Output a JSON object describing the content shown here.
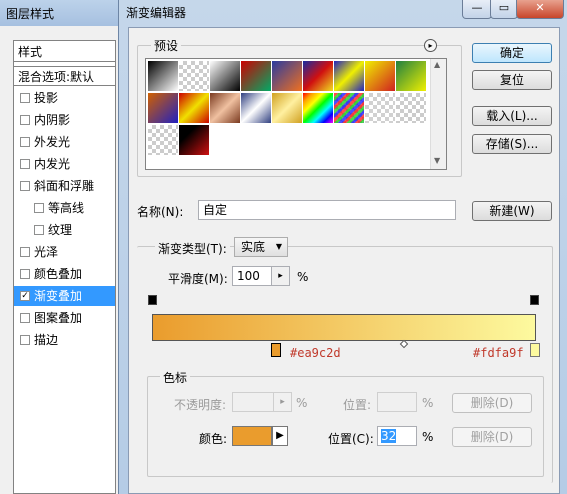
{
  "left_window": {
    "title": "图层样式",
    "header": "样式",
    "blend": "混合选项:默认",
    "items": [
      {
        "label": "投影",
        "checked": false,
        "indent": false
      },
      {
        "label": "内阴影",
        "checked": false,
        "indent": false
      },
      {
        "label": "外发光",
        "checked": false,
        "indent": false
      },
      {
        "label": "内发光",
        "checked": false,
        "indent": false
      },
      {
        "label": "斜面和浮雕",
        "checked": false,
        "indent": false
      },
      {
        "label": "等高线",
        "checked": false,
        "indent": true
      },
      {
        "label": "纹理",
        "checked": false,
        "indent": true
      },
      {
        "label": "光泽",
        "checked": false,
        "indent": false
      },
      {
        "label": "颜色叠加",
        "checked": false,
        "indent": false
      },
      {
        "label": "渐变叠加",
        "checked": true,
        "indent": false,
        "selected": true
      },
      {
        "label": "图案叠加",
        "checked": false,
        "indent": false
      },
      {
        "label": "描边",
        "checked": false,
        "indent": false
      }
    ]
  },
  "window": {
    "title": "渐变编辑器",
    "minimize": "—",
    "restore": "▭",
    "close": "✕"
  },
  "presets": {
    "label": "预设",
    "menu_icon": "▸",
    "scroll_up": "▲",
    "scroll_down": "▼"
  },
  "buttons": {
    "ok": "确定",
    "reset": "复位",
    "load": "载入(L)...",
    "save": "存储(S)...",
    "new": "新建(W)"
  },
  "name": {
    "label": "名称(N):",
    "value": "自定"
  },
  "gradient_type": {
    "label": "渐变类型(T):",
    "value": "实底",
    "arrow": "▼"
  },
  "smoothness": {
    "label": "平滑度(M):",
    "value": "100",
    "unit": "%",
    "arrow": "▸"
  },
  "gradient": {
    "start_color": "#ea9c2d",
    "end_color": "#fdfa9f",
    "start_label": "#ea9c2d",
    "end_label": "#fdfa9f"
  },
  "stops": {
    "label": "色标",
    "opacity_label": "不透明度:",
    "opacity_unit": "%",
    "opacity_arrow": "▸",
    "position_label_top": "位置:",
    "position_unit_top": "%",
    "delete_top": "删除(D)",
    "color_label": "颜色:",
    "color_value": "#ea9c2d",
    "color_arrow": "▶",
    "position_label": "位置(C):",
    "position_value": "32",
    "position_unit": "%",
    "delete_bottom": "删除(D)"
  }
}
